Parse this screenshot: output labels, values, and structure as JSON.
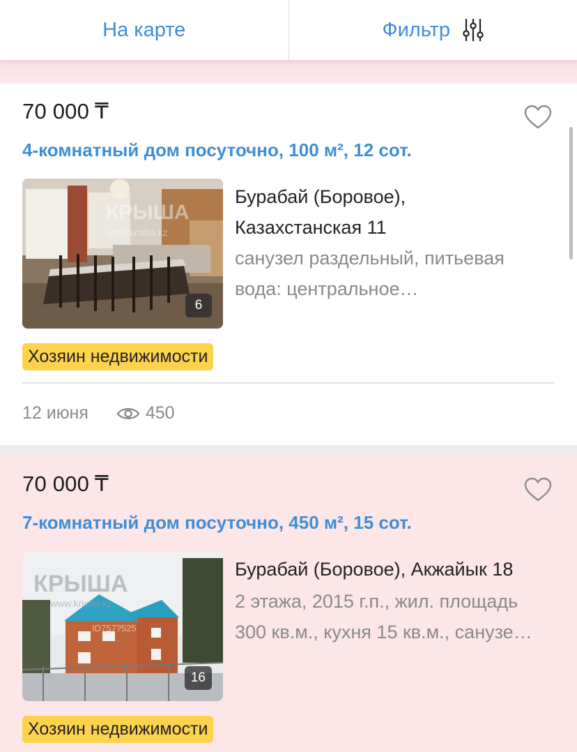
{
  "topbar": {
    "map_label": "На карте",
    "filter_label": "Фильтр"
  },
  "listings": [
    {
      "price": "70 000",
      "currency": "₸",
      "title": "4-комнатный дом посуточно, 100 м², 12 сот.",
      "address_line1": "Бурабай (Боровое),",
      "address_line2": "Казахстанская 11",
      "description_line1": "санузел раздельный, питьевая",
      "description_line2": "вода: центральное…",
      "photo_count": "6",
      "photo_watermark": "КРЫША",
      "photo_url": "www.krisha.kz",
      "badge": "Хозяин недвижимости",
      "date": "12 июня",
      "views": "450"
    },
    {
      "price": "70 000",
      "currency": "₸",
      "title": "7-комнатный дом посуточно, 450 м², 15 сот.",
      "address_line1": "Бурабай (Боровое), Акжайык 18",
      "description_line1": "2 этажа, 2015 г.п., жил. площадь",
      "description_line2": "300 кв.м., кухня 15 кв.м., санузе…",
      "photo_count": "16",
      "photo_watermark": "КРЫША",
      "photo_url": "www.krisha.kz",
      "photo_id": "ID757?525",
      "badge": "Хозяин недвижимости"
    }
  ],
  "colors": {
    "accent_blue": "#3f8ed6",
    "badge_yellow": "#fcd34d",
    "highlight_pink": "#fde6e8"
  },
  "icons": [
    "sliders-filter-icon",
    "heart-outline-icon",
    "eye-icon"
  ]
}
